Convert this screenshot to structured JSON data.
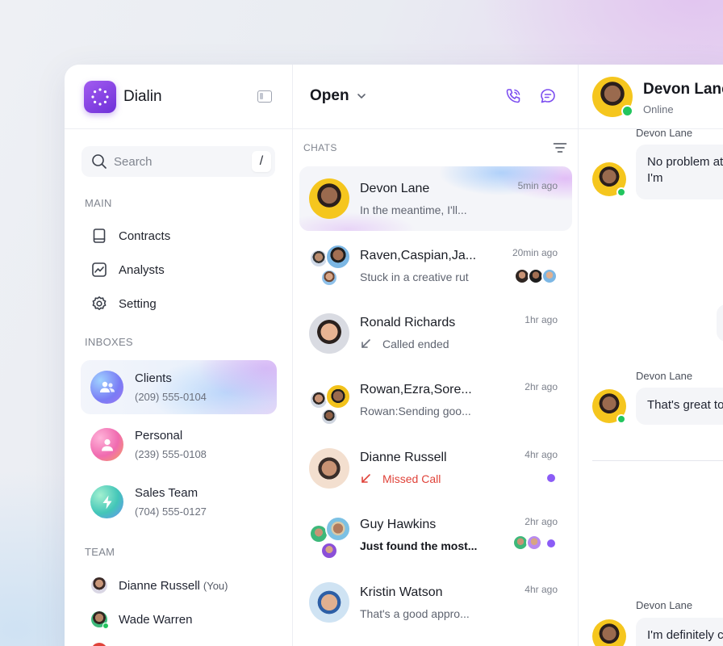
{
  "app": {
    "name": "Dialin",
    "colors": {
      "accent": "#8b5cf6",
      "online": "#22c55e",
      "missed": "#e0433a"
    }
  },
  "sidebar": {
    "search": {
      "placeholder": "Search",
      "shortcut": "/"
    },
    "main_label": "MAIN",
    "main_items": [
      {
        "label": "Contracts",
        "icon": "book-icon"
      },
      {
        "label": "Analysts",
        "icon": "chart-icon"
      },
      {
        "label": "Setting",
        "icon": "gear-icon"
      }
    ],
    "inboxes_label": "INBOXES",
    "inboxes": [
      {
        "name": "Clients",
        "phone": "(209) 555-0104",
        "icon": "users-icon",
        "active": true
      },
      {
        "name": "Personal",
        "phone": "(239) 555-0108",
        "icon": "user-icon",
        "active": false
      },
      {
        "name": "Sales Team",
        "phone": "(704) 555-0127",
        "icon": "bolt-icon",
        "active": false
      }
    ],
    "team_label": "TEAM",
    "team": [
      {
        "name": "Dianne Russell",
        "suffix": "(You)"
      },
      {
        "name": "Wade Warren",
        "suffix": ""
      }
    ]
  },
  "chatlist": {
    "filter": "Open",
    "section_label": "CHATS",
    "chats": [
      {
        "name": "Devon Lane",
        "preview": "In the meantime, I'll...",
        "time": "5min ago",
        "active": true
      },
      {
        "name": "Raven,Caspian,Ja...",
        "preview": "Stuck in a creative rut",
        "time": "20min ago"
      },
      {
        "name": "Ronald Richards",
        "preview": "Called ended",
        "time": "1hr ago"
      },
      {
        "name": "Rowan,Ezra,Sore...",
        "preview": "Rowan:Sending goo...",
        "time": "2hr ago"
      },
      {
        "name": "Dianne Russell",
        "preview": "Missed Call",
        "time": "4hr ago"
      },
      {
        "name": "Guy Hawkins",
        "preview": "Just found the most...",
        "time": "2hr ago"
      },
      {
        "name": "Kristin Watson",
        "preview": "That's a good appro...",
        "time": "4hr ago"
      }
    ]
  },
  "conversation": {
    "contact_name": "Devon Lane",
    "status": "Online",
    "messages": [
      {
        "sender": "Devon Lane",
        "text": "No problem at while and I'm"
      },
      {
        "sender": "Devon Lane",
        "text": "That's great to"
      },
      {
        "sender": "Devon Lane",
        "text": "I'm definitely c"
      }
    ]
  }
}
